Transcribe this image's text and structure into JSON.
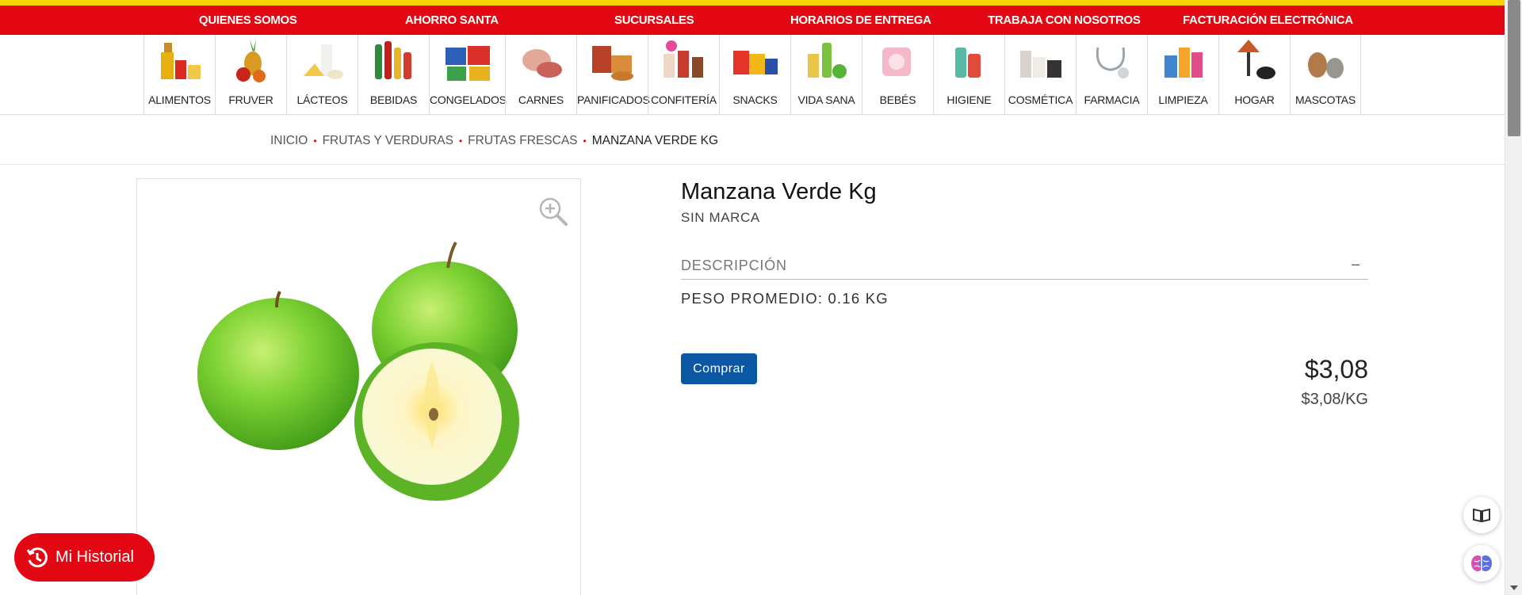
{
  "top_nav": [
    {
      "label": "QUIENES SOMOS"
    },
    {
      "label": "AHORRO SANTA"
    },
    {
      "label": "SUCURSALES"
    },
    {
      "label": "HORARIOS DE ENTREGA"
    },
    {
      "label": "TRABAJA CON NOSOTROS"
    },
    {
      "label": "FACTURACIÓN ELECTRÓNICA"
    }
  ],
  "categories": [
    {
      "label": "ALIMENTOS"
    },
    {
      "label": "FRUVER"
    },
    {
      "label": "LÁCTEOS"
    },
    {
      "label": "BEBIDAS"
    },
    {
      "label": "CONGELADOS"
    },
    {
      "label": "CARNES"
    },
    {
      "label": "PANIFICADOS"
    },
    {
      "label": "CONFITERÍA"
    },
    {
      "label": "SNACKS"
    },
    {
      "label": "VIDA SANA"
    },
    {
      "label": "BEBÉS"
    },
    {
      "label": "HIGIENE"
    },
    {
      "label": "COSMÉTICA"
    },
    {
      "label": "FARMACIA"
    },
    {
      "label": "LIMPIEZA"
    },
    {
      "label": "HOGAR"
    },
    {
      "label": "MASCOTAS"
    }
  ],
  "breadcrumb": {
    "items": [
      "INICIO",
      "FRUTAS Y VERDURAS",
      "FRUTAS FRESCAS"
    ],
    "current": "MANZANA VERDE KG"
  },
  "product": {
    "title": "Manzana Verde Kg",
    "brand": "SIN MARCA",
    "description_heading": "DESCRIPCIÓN",
    "description_toggle": "–",
    "description_body": "PESO PROMEDIO: 0.16 KG",
    "buy_label": "Comprar",
    "price": "$3,08",
    "unit_price": "$3,08/KG"
  },
  "history_button": {
    "label": "Mi Historial"
  },
  "icons": {
    "zoom": "zoom-in-icon",
    "history": "clock-history-icon",
    "reader": "book-icon",
    "assistant": "brain-icon"
  },
  "colors": {
    "brand_red": "#e30613",
    "brand_yellow": "#f5d200",
    "buy_blue": "#0b57a4"
  }
}
